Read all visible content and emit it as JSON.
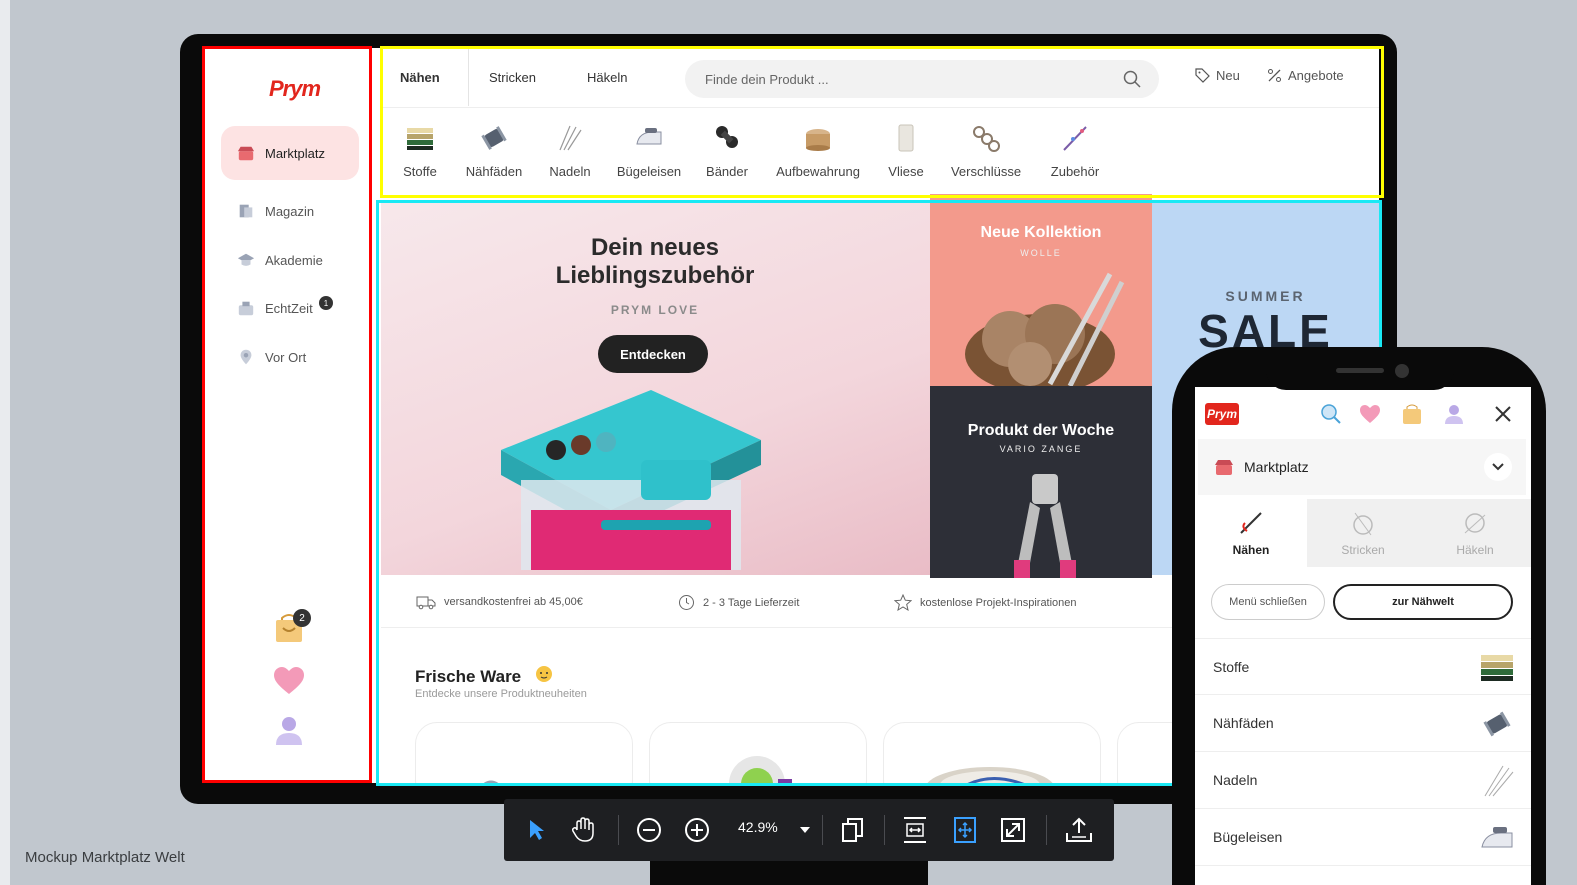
{
  "canvas": {
    "label": "Mockup Marktplatz Welt"
  },
  "sidebar": {
    "logo": "Prym",
    "items": [
      {
        "label": "Marktplatz",
        "icon": "shop-icon",
        "active": true
      },
      {
        "label": "Magazin",
        "icon": "magazine-icon"
      },
      {
        "label": "Akademie",
        "icon": "graduation-cap-icon"
      },
      {
        "label": "EchtZeit",
        "icon": "live-icon",
        "badge": "1"
      },
      {
        "label": "Vor Ort",
        "icon": "location-pin-icon"
      }
    ],
    "cart_badge": "2"
  },
  "topnav": {
    "tabs": [
      "Nähen",
      "Stricken",
      "Häkeln"
    ],
    "search_placeholder": "Finde dein Produkt ...",
    "new_label": "Neu",
    "offers_label": "Angebote"
  },
  "categories": [
    "Stoffe",
    "Nähfäden",
    "Nadeln",
    "Bügeleisen",
    "Bänder",
    "Aufbewahrung",
    "Vliese",
    "Verschlüsse",
    "Zubehör"
  ],
  "hero": {
    "title_line1": "Dein neues",
    "title_line2": "Lieblingszubehör",
    "subtitle": "PRYM LOVE",
    "button": "Entdecken"
  },
  "tiles": {
    "collection_title": "Neue Kollektion",
    "collection_sub": "WOLLE",
    "product_title": "Produkt der Woche",
    "product_sub": "VARIO ZANGE",
    "sale_small": "SUMMER",
    "sale_big": "SALE"
  },
  "usp": [
    "versandkostenfrei ab 45,00€",
    "2 - 3 Tage Lieferzeit",
    "kostenlose Projekt-Inspirationen"
  ],
  "fresh": {
    "title": "Frische Ware",
    "subtitle": "Entdecke unsere Produktneuheiten"
  },
  "mobile": {
    "logo": "Prym",
    "marketplace": "Marktplatz",
    "tabs": [
      "Nähen",
      "Stricken",
      "Häkeln"
    ],
    "close_menu": "Menü schließen",
    "to_world": "zur Nähwelt",
    "list": [
      "Stoffe",
      "Nähfäden",
      "Nadeln",
      "Bügeleisen"
    ]
  },
  "toolbar": {
    "zoom": "42.9%"
  },
  "colors": {
    "brand": "#e2261d",
    "frame_sidebar": "#ff0000",
    "frame_header": "#ffff00",
    "frame_content": "#19e9f4"
  }
}
